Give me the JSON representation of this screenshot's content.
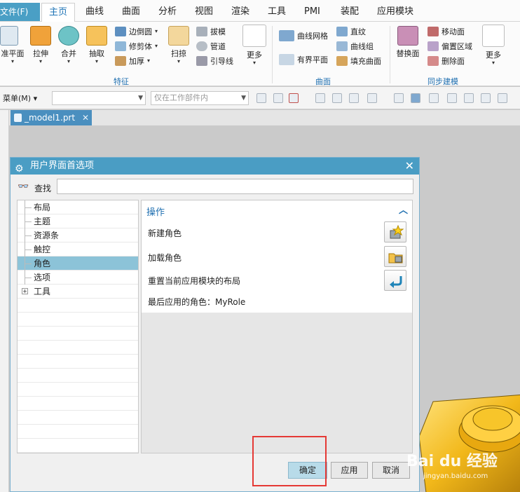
{
  "menu": {
    "file": "文件(F)",
    "tabs": [
      "主页",
      "曲线",
      "曲面",
      "分析",
      "视图",
      "渲染",
      "工具",
      "PMI",
      "装配",
      "应用模块"
    ]
  },
  "ribbon": {
    "big": {
      "datum_plane": "准平面",
      "extrude": "拉伸",
      "unite": "合并",
      "extract": "抽取",
      "sweep": "扫掠",
      "more_feature": "更多",
      "replace_face": "替换面",
      "more_sync": "更多"
    },
    "small": {
      "edge_blend": "边倒圆",
      "trim_body": "修剪体",
      "thicken": "加厚",
      "draft": "拔模",
      "tube": "管道",
      "guide_line": "引导线",
      "mesh_surface": "曲线网格",
      "bounded_plane": "有界平面",
      "ruled": "直纹",
      "curve_group": "曲线组",
      "fill_surface": "填充曲面",
      "move_face": "移动面",
      "offset_region": "偏置区域",
      "delete_face": "删除面"
    },
    "groups": {
      "feature": "特征",
      "surface": "曲面",
      "sync": "同步建模"
    }
  },
  "toolbar": {
    "menu_label": "菜单(M)",
    "scope_placeholder": "仅在工作部件内"
  },
  "file_tab": {
    "name": "_model1.prt",
    "close": "✕"
  },
  "dialog": {
    "title": "用户界面首选项",
    "search_label": "查找",
    "search_value": "",
    "tree": [
      "布局",
      "主题",
      "资源条",
      "触控",
      "角色",
      "选项",
      "工具"
    ],
    "selected": "角色",
    "panel": {
      "header": "操作",
      "new_role": "新建角色",
      "load_role": "加载角色",
      "reset_layout": "重置当前应用模块的布局",
      "last_role": "最后应用的角色：MyRole"
    },
    "buttons": {
      "ok": "确定",
      "apply": "应用",
      "cancel": "取消"
    }
  },
  "watermark": {
    "brand": "Bai du 经验",
    "url": "jingyan.baidu.com"
  },
  "colors": {
    "accent": "#4a9dc4",
    "selection": "#8cc3d8",
    "highlight_box": "#e53935",
    "model": "#f2b81a"
  }
}
